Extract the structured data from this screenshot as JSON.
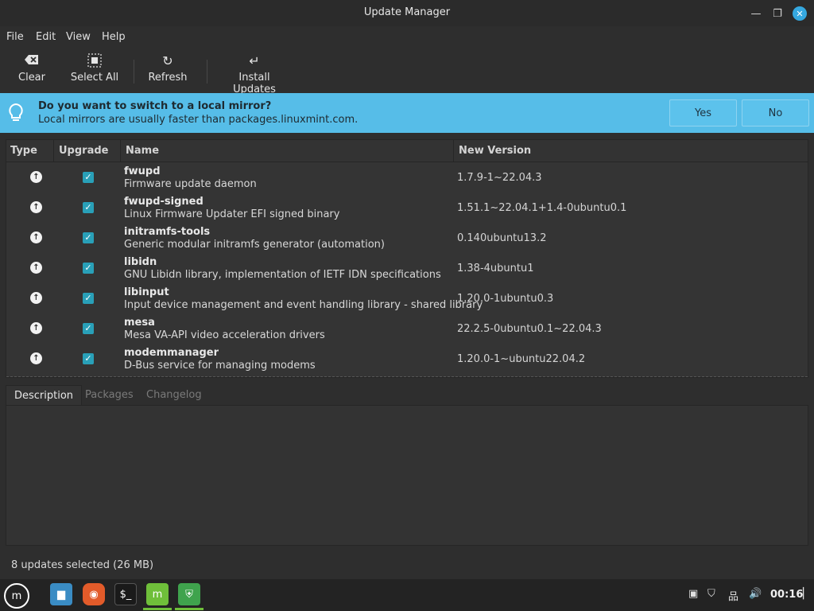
{
  "window": {
    "title": "Update Manager",
    "min_icon": "minimize-icon",
    "max_icon": "maximize-icon",
    "close_icon": "close-icon"
  },
  "menubar": {
    "items": [
      "File",
      "Edit",
      "View",
      "Help"
    ]
  },
  "toolbar": {
    "clear": "Clear",
    "select_all": "Select All",
    "refresh": "Refresh",
    "install": "Install Updates"
  },
  "infobar": {
    "title": "Do you want to switch to a local mirror?",
    "subtitle": "Local mirrors are usually faster than packages.linuxmint.com.",
    "yes": "Yes",
    "no": "No",
    "accent": "#56bde8"
  },
  "list": {
    "columns": {
      "type": "Type",
      "upgrade": "Upgrade",
      "name": "Name",
      "version": "New Version"
    },
    "rows": [
      {
        "name": "fwupd",
        "desc": "Firmware update daemon",
        "version": "1.7.9-1~22.04.3"
      },
      {
        "name": "fwupd-signed",
        "desc": "Linux Firmware Updater EFI signed binary",
        "version": "1.51.1~22.04.1+1.4-0ubuntu0.1"
      },
      {
        "name": "initramfs-tools",
        "desc": "Generic modular initramfs generator (automation)",
        "version": "0.140ubuntu13.2"
      },
      {
        "name": "libidn",
        "desc": "GNU Libidn library, implementation of IETF IDN specifications",
        "version": "1.38-4ubuntu1"
      },
      {
        "name": "libinput",
        "desc": "Input device management and event handling library - shared library",
        "version": "1.20.0-1ubuntu0.3"
      },
      {
        "name": "mesa",
        "desc": "Mesa VA-API video acceleration drivers",
        "version": "22.2.5-0ubuntu0.1~22.04.3"
      },
      {
        "name": "modemmanager",
        "desc": "D-Bus service for managing modems",
        "version": "1.20.0-1~ubuntu22.04.2"
      }
    ]
  },
  "tabs": [
    "Description",
    "Packages",
    "Changelog"
  ],
  "status": "8 updates selected (26 MB)",
  "taskbar": {
    "clock": "00:16"
  }
}
